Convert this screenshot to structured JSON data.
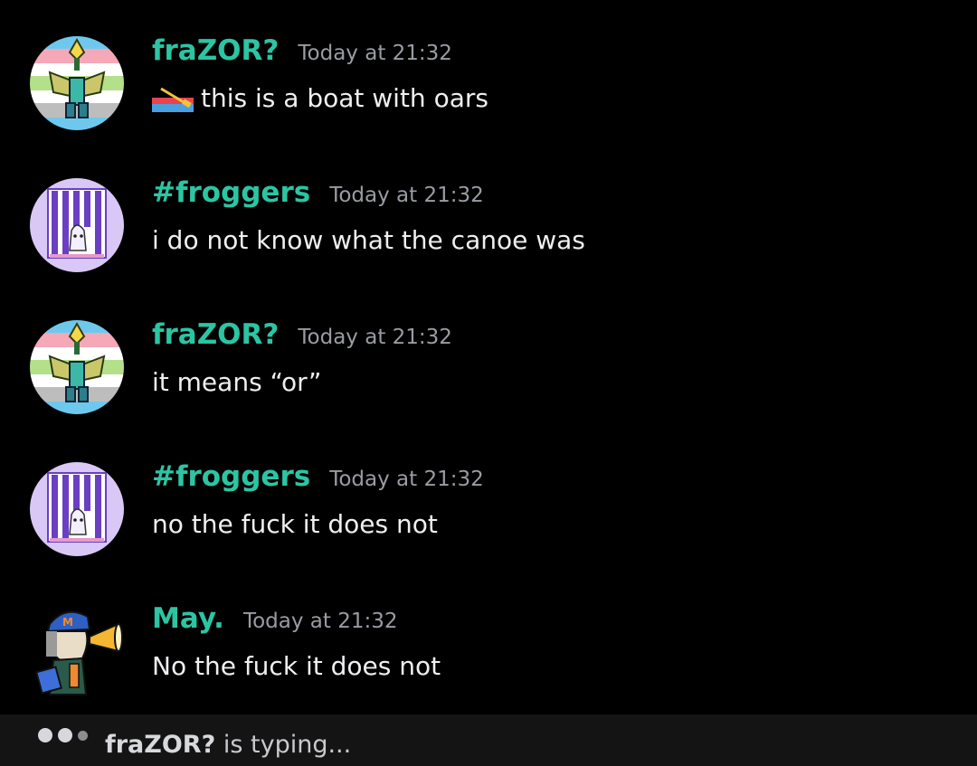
{
  "messages": [
    {
      "author": "fraZOR?",
      "timestamp": "Today at 21:32",
      "emoji": "canoe-icon",
      "text": "this is a boat with oars"
    },
    {
      "author": "#froggers",
      "timestamp": "Today at 21:32",
      "text": "i do not know what the canoe was"
    },
    {
      "author": "fraZOR?",
      "timestamp": "Today at 21:32",
      "text": "it means “or”"
    },
    {
      "author": "#froggers",
      "timestamp": "Today at 21:32",
      "text": "no the fuck it does not"
    },
    {
      "author": "May.",
      "timestamp": "Today at 21:32",
      "text": "No the fuck it does not"
    }
  ],
  "typing": {
    "name": "fraZOR?",
    "suffix": " is typing..."
  },
  "colors": {
    "background": "#000000",
    "username": "#2cc5a3",
    "timestamp": "#9a9ca3",
    "message_text": "#eeeff1",
    "typing_bar": "#141414"
  }
}
